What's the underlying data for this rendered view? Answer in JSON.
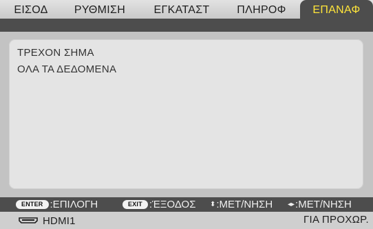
{
  "tabs": [
    {
      "label": "ΕΙΣΟΔ",
      "active": false
    },
    {
      "label": "ΡΥΘΜΙΣΗ",
      "active": false
    },
    {
      "label": "ΕΓΚΑΤΑΣΤ",
      "active": false
    },
    {
      "label": "ΠΛΗΡΟΦ",
      "active": false
    },
    {
      "label": "ΕΠΑΝΑΦ",
      "active": true
    }
  ],
  "menu": {
    "items": [
      {
        "label": "ΤΡΕΧΟΝ ΣΗΜΑ"
      },
      {
        "label": "ΟΛΑ ΤΑ ΔΕΔΟΜΕΝΑ"
      }
    ]
  },
  "hints": {
    "enter_key": "ENTER",
    "enter_label": ":ΕΠΙΛΟΓΗ",
    "exit_key": "EXIT",
    "exit_label": ":ΈΞΟΔΟΣ",
    "vertical_arrow": "⬍",
    "vertical_label": ":ΜΕΤ/ΝΗΣΗ",
    "horizontal_arrow": "◂▸",
    "horizontal_label": ":ΜΕΤ/ΝΗΣΗ"
  },
  "status": {
    "source": "HDMI1",
    "mode": "ΓΙΑ ΠΡΟΧΩΡ."
  },
  "colors": {
    "active_tab_text": "#ffe53a",
    "active_tab_bg": "#4d4d4d",
    "panel_bg": "#e4e4e4"
  }
}
